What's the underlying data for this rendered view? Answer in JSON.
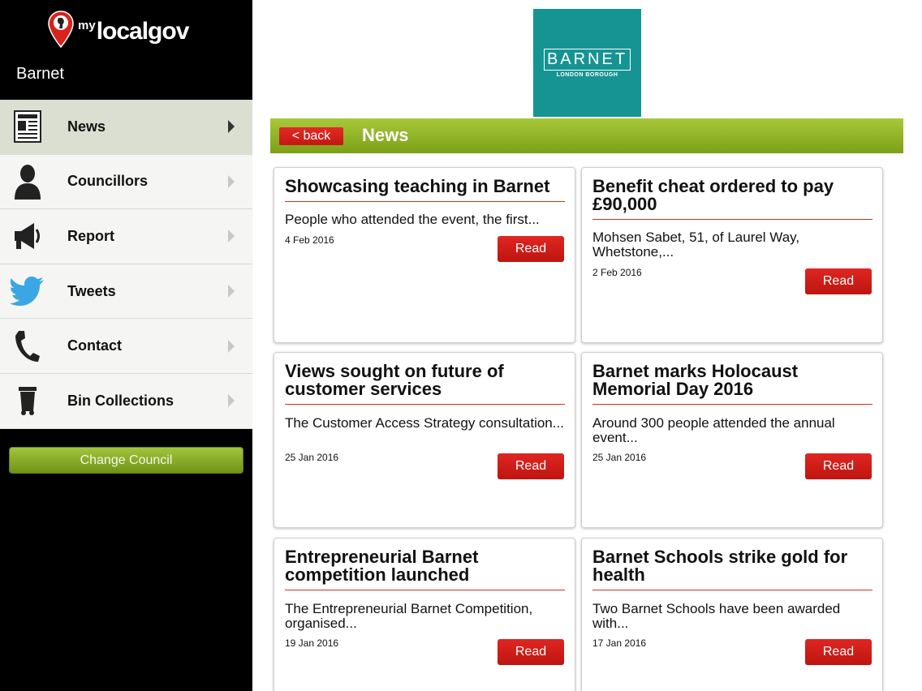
{
  "app": {
    "logo_prefix": "my",
    "logo_word": "localgov",
    "council_name": "Barnet"
  },
  "sidebar": {
    "items": [
      {
        "label": "News",
        "icon": "newspaper-icon",
        "active": true
      },
      {
        "label": "Councillors",
        "icon": "person-icon",
        "active": false
      },
      {
        "label": "Report",
        "icon": "megaphone-icon",
        "active": false
      },
      {
        "label": "Tweets",
        "icon": "twitter-bird-icon",
        "active": false
      },
      {
        "label": "Contact",
        "icon": "phone-icon",
        "active": false
      },
      {
        "label": "Bin Collections",
        "icon": "wheelie-bin-icon",
        "active": false
      }
    ],
    "change_council_label": "Change Council"
  },
  "brand": {
    "word": "BARNET",
    "sub": "LONDON BOROUGH",
    "color": "#169494"
  },
  "header": {
    "back_label": "< back",
    "title": "News"
  },
  "news": [
    {
      "title": "Showcasing teaching in Barnet",
      "excerpt": "People who attended the event, the first...",
      "date": "4 Feb 2016",
      "read_label": "Read"
    },
    {
      "title": "Benefit cheat ordered to pay £90,000",
      "excerpt": "Mohsen Sabet, 51, of Laurel Way, Whetstone,...",
      "date": "2 Feb 2016",
      "read_label": "Read"
    },
    {
      "title": "Views sought on future of customer services",
      "excerpt": "The Customer Access Strategy consultation...",
      "date": "25 Jan 2016",
      "read_label": "Read"
    },
    {
      "title": "Barnet marks Holocaust Memorial Day 2016",
      "excerpt": "Around 300 people attended the annual event...",
      "date": "25 Jan 2016",
      "read_label": "Read"
    },
    {
      "title": "Entrepreneurial Barnet competition launched",
      "excerpt": "The Entrepreneurial Barnet Competition, organised...",
      "date": "19 Jan 2016",
      "read_label": "Read"
    },
    {
      "title": "Barnet Schools strike gold for health",
      "excerpt": "Two Barnet Schools have been awarded with...",
      "date": "17 Jan 2016",
      "read_label": "Read"
    }
  ],
  "colors": {
    "accent_green": "#8fb126",
    "accent_red": "#d32f22",
    "sidebar_bg": "#000000"
  }
}
